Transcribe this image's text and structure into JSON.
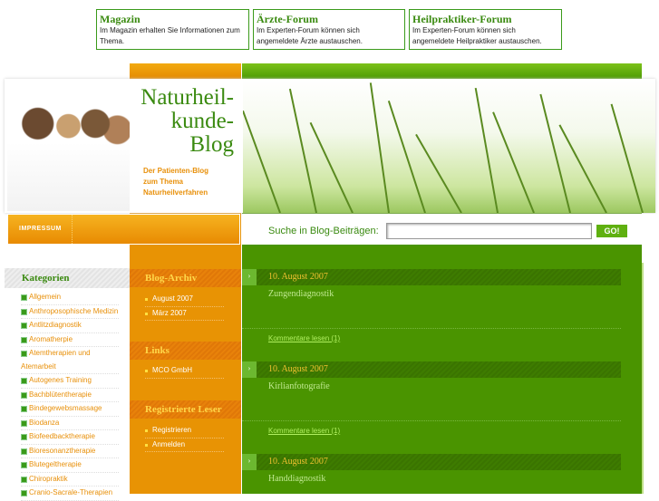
{
  "top_boxes": [
    {
      "title": "Magazin",
      "text": "Im Magazin erhalten Sie Informationen zum Thema."
    },
    {
      "title": "Ärzte-Forum",
      "text": "Im Experten-Forum können sich angemeldete Ärzte austauschen."
    },
    {
      "title": "Heilpraktiker-Forum",
      "text": "Im Experten-Forum können sich angemeldete Heilpraktiker austauschen."
    }
  ],
  "header": {
    "title_1": "Naturheil-",
    "title_2": "kunde-",
    "title_3": "Blog",
    "subtitle_1": "Der Patienten-Blog",
    "subtitle_2": "zum Thema",
    "subtitle_3": "Naturheilverfahren",
    "impressum": "IMPRESSUM"
  },
  "search": {
    "label": "Suche in Blog-Beiträgen:",
    "value": "",
    "button": "GO!"
  },
  "categories": {
    "title": "Kategorien",
    "items": [
      "Allgemein",
      "Anthroposophische Medizin",
      "Antlitzdiagnostik",
      "Aromatherpie",
      "Atemtherapien und",
      "Atemarbeit",
      "Autogenes Training",
      "Bachblütentherapie",
      "Bindegewebsmassage",
      "Biodanza",
      "Biofeedbacktherapie",
      "Bioresonanztherapie",
      "Blutegeltherapie",
      "Chiropraktik",
      "Cranio-Sacrale-Therapien"
    ]
  },
  "archive": {
    "title": "Blog-Archiv",
    "items": [
      "August 2007",
      "März 2007"
    ]
  },
  "links": {
    "title": "Links",
    "items": [
      "MCO GmbH"
    ]
  },
  "readers": {
    "title": "Registrierte Leser",
    "items": [
      "Registrieren",
      "Anmelden"
    ]
  },
  "posts": [
    {
      "date": "10. August 2007",
      "title": "Zungendiagnostik",
      "comments": "Kommentare lesen (1)"
    },
    {
      "date": "10. August 2007",
      "title": "Kirlianfotografie",
      "comments": "Kommentare lesen (1)"
    },
    {
      "date": "10. August 2007",
      "title": "Handdiagnostik"
    }
  ],
  "colors": {
    "green": "#4a9400",
    "orange": "#e89304",
    "title_green": "#3a8a10"
  }
}
